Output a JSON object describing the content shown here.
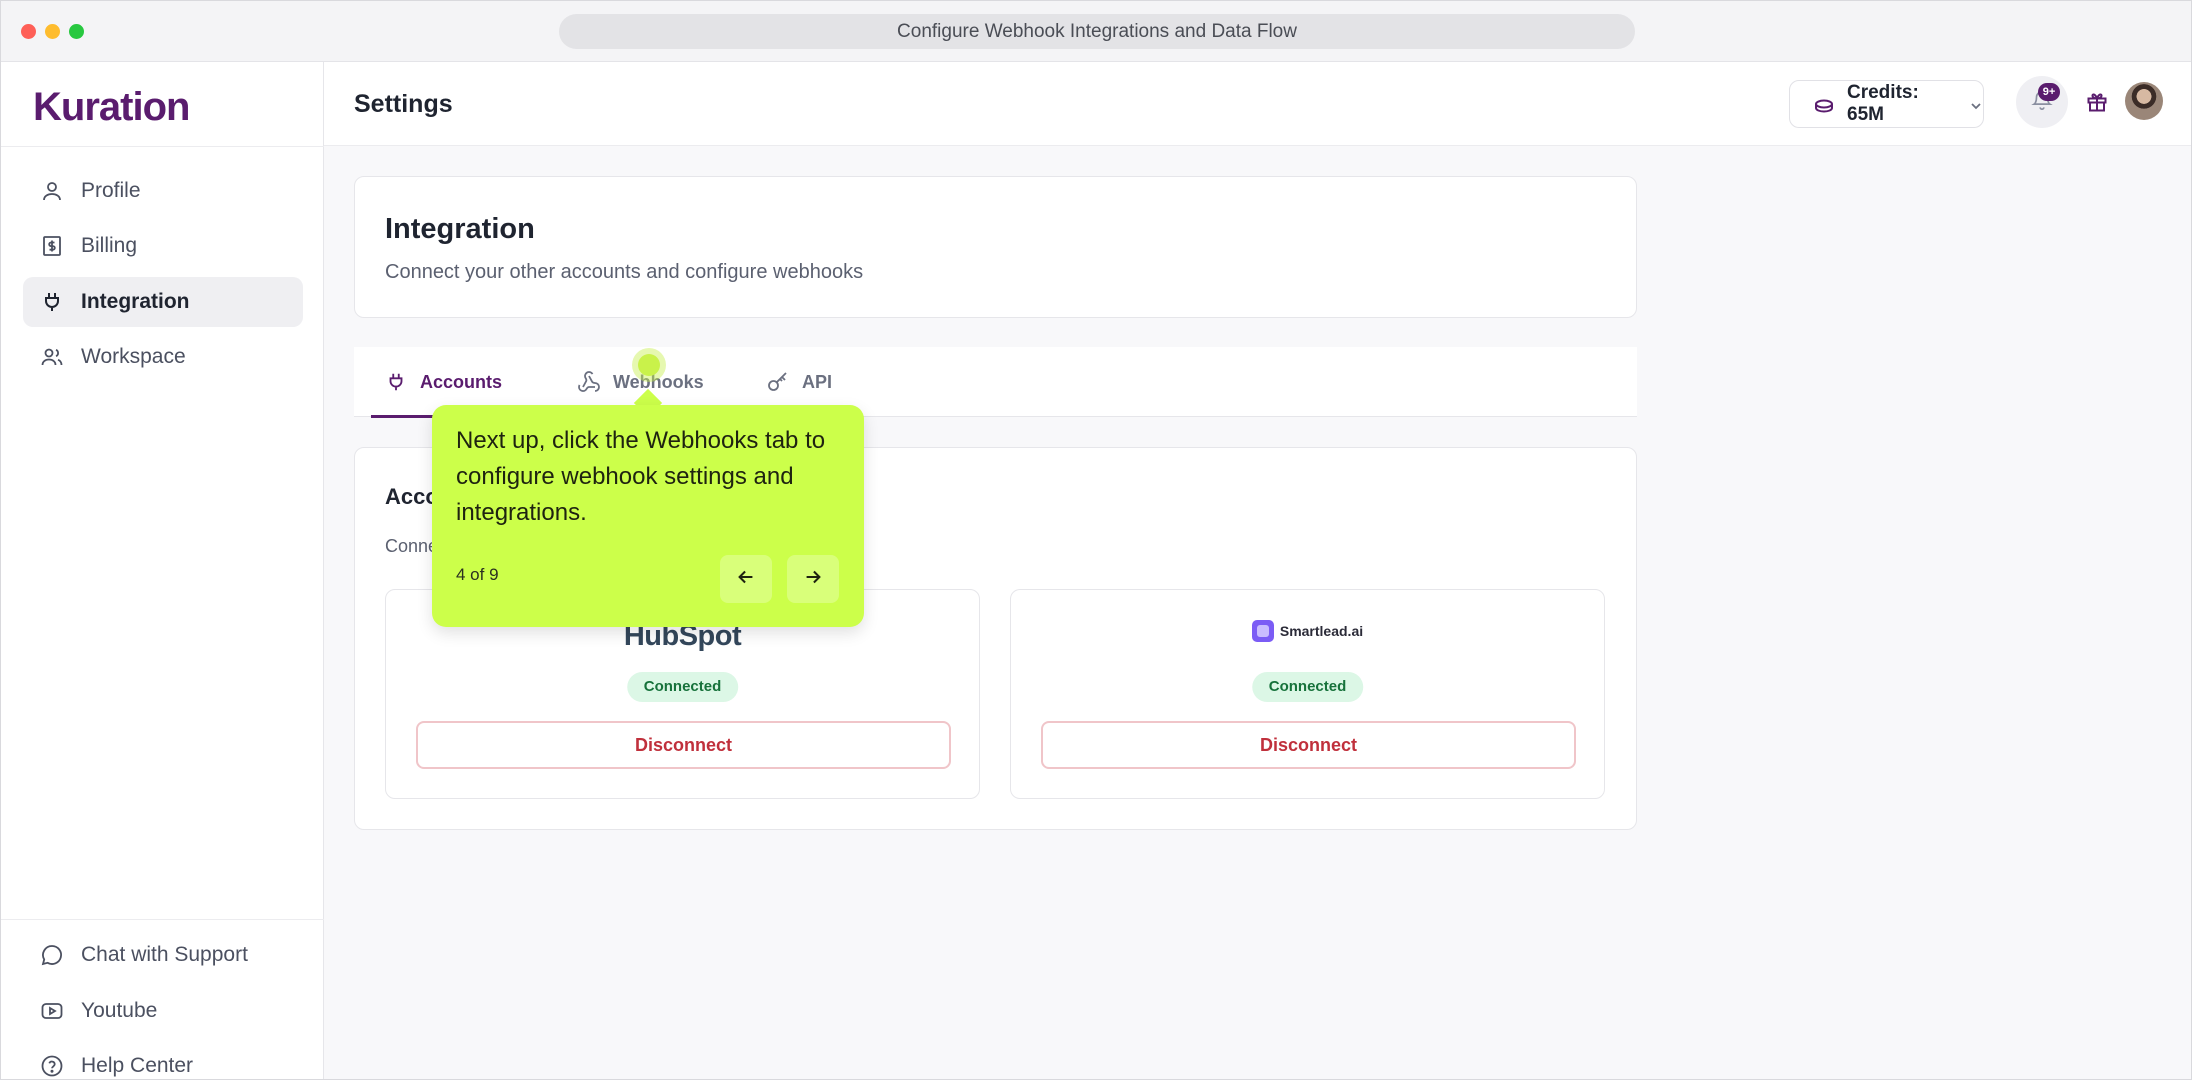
{
  "window": {
    "url_title": "Configure Webhook Integrations and Data Flow"
  },
  "brand": {
    "name": "Kuration",
    "color": "#5a1c6e"
  },
  "sidebar": {
    "items": [
      {
        "label": "Profile",
        "icon": "user-icon"
      },
      {
        "label": "Billing",
        "icon": "billing-icon"
      },
      {
        "label": "Integration",
        "icon": "plug-icon",
        "active": true
      },
      {
        "label": "Workspace",
        "icon": "users-icon"
      }
    ],
    "bottom_items": [
      {
        "label": "Chat with Support",
        "icon": "chat-icon"
      },
      {
        "label": "Youtube",
        "icon": "youtube-icon"
      },
      {
        "label": "Help Center",
        "icon": "help-icon"
      }
    ]
  },
  "header": {
    "title": "Settings",
    "credits_label": "Credits: 65M",
    "notification_badge": "9+"
  },
  "integration": {
    "title": "Integration",
    "subtitle": "Connect your other accounts and configure webhooks"
  },
  "tabs": [
    {
      "label": "Accounts",
      "icon": "plug-icon",
      "active": true
    },
    {
      "label": "Webhooks",
      "icon": "webhook-icon"
    },
    {
      "label": "API",
      "icon": "key-icon"
    }
  ],
  "accounts": {
    "title": "Acco",
    "subtitle": "Conne",
    "integrations": [
      {
        "name": "HubSpot",
        "status": "Connected",
        "action": "Disconnect"
      },
      {
        "name": "Smartlead.ai",
        "status": "Connected",
        "action": "Disconnect"
      }
    ]
  },
  "tour": {
    "text": "Next up, click the Webhooks tab to configure webhook settings and integrations.",
    "step": "4 of 9",
    "accent": "#ccff4a"
  }
}
